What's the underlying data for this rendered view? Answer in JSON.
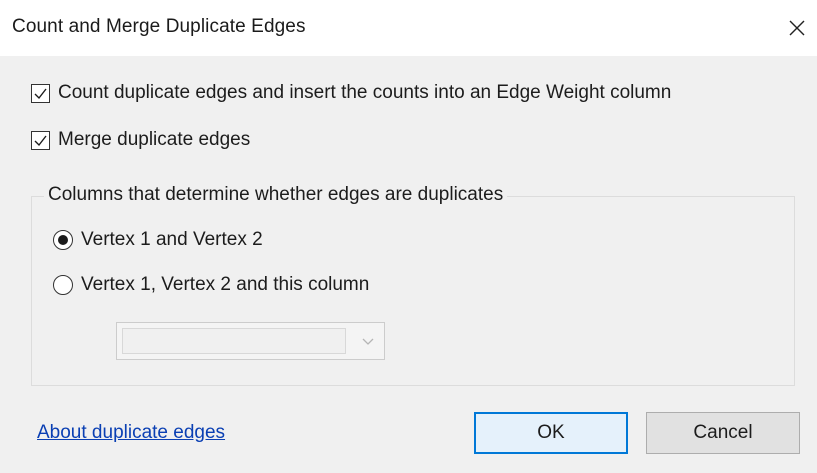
{
  "window": {
    "title": "Count and Merge Duplicate Edges",
    "close_icon": "close-icon"
  },
  "options": {
    "count_label": "Count duplicate edges and insert the counts into an Edge Weight column",
    "count_checked": true,
    "merge_label": "Merge duplicate edges",
    "merge_checked": true
  },
  "columns_group": {
    "legend": "Columns that determine whether edges are duplicates",
    "radio_vertex12_label": "Vertex 1 and Vertex 2",
    "radio_vertex12_selected": true,
    "radio_this_column_label": "Vertex 1, Vertex 2 and this column",
    "radio_this_column_selected": false,
    "column_select_value": "",
    "column_select_disabled": true
  },
  "footer": {
    "help_link": "About duplicate edges",
    "ok_label": "OK",
    "cancel_label": "Cancel"
  },
  "colors": {
    "link": "#0a3fb3",
    "accent": "#0078d7",
    "client_bg": "#f0f0f0"
  }
}
